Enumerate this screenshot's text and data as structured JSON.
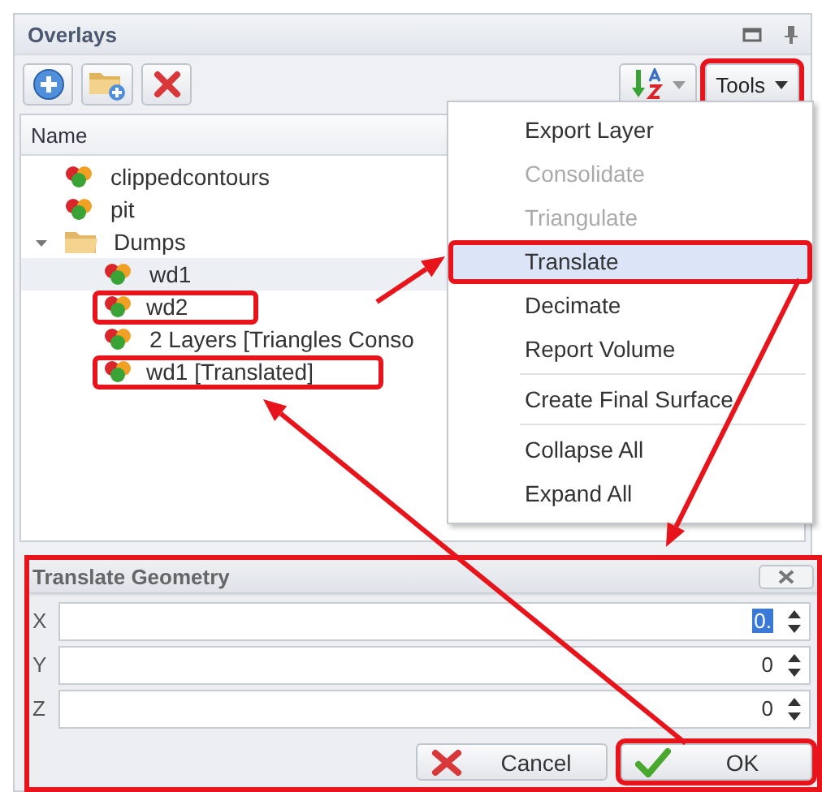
{
  "panel": {
    "title": "Overlays"
  },
  "toolbar": {
    "buttons": [
      {
        "kind": "add"
      },
      {
        "kind": "add-folder"
      },
      {
        "kind": "delete"
      },
      {
        "kind": "sort"
      }
    ],
    "tools": {
      "label": "Tools",
      "highlighted": true
    }
  },
  "tree": {
    "column": "Name",
    "items": [
      {
        "label": "clippedcontours",
        "kind": "layer",
        "hovered": false,
        "highlighted": false
      },
      {
        "label": "pit",
        "kind": "layer",
        "hovered": false,
        "highlighted": false
      },
      {
        "label": "Dumps",
        "kind": "folder",
        "expanded": true,
        "hovered": false,
        "highlighted": false,
        "children": [
          {
            "label": "wd1",
            "kind": "layer",
            "hovered": true,
            "highlighted": false
          },
          {
            "label": "wd2",
            "kind": "layer",
            "hovered": false,
            "highlighted": true
          },
          {
            "label": "2 Layers [Triangles Conso",
            "kind": "layer",
            "hovered": false,
            "highlighted": false
          },
          {
            "label": "wd1 [Translated]",
            "kind": "layer",
            "hovered": false,
            "highlighted": true
          }
        ]
      }
    ]
  },
  "menu": {
    "items": [
      {
        "label": "Export Layer",
        "disabled": false,
        "selected": false,
        "highlighted": false,
        "separator_before": false
      },
      {
        "label": "Consolidate",
        "disabled": true,
        "selected": false,
        "highlighted": false,
        "separator_before": false
      },
      {
        "label": "Triangulate",
        "disabled": true,
        "selected": false,
        "highlighted": false,
        "separator_before": false
      },
      {
        "label": "Translate",
        "disabled": false,
        "selected": true,
        "highlighted": true,
        "separator_before": false
      },
      {
        "label": "Decimate",
        "disabled": false,
        "selected": false,
        "highlighted": false,
        "separator_before": false
      },
      {
        "label": "Report Volume",
        "disabled": false,
        "selected": false,
        "highlighted": false,
        "separator_before": false
      },
      {
        "label": "Create Final Surface",
        "disabled": false,
        "selected": false,
        "highlighted": false,
        "separator_before": true
      },
      {
        "label": "Collapse All",
        "disabled": false,
        "selected": false,
        "highlighted": false,
        "separator_before": true
      },
      {
        "label": "Expand All",
        "disabled": false,
        "selected": false,
        "highlighted": false,
        "separator_before": false
      }
    ]
  },
  "dialog": {
    "title": "Translate Geometry",
    "highlighted": true,
    "fields": [
      {
        "label": "X",
        "value": "0.",
        "focused": true
      },
      {
        "label": "Y",
        "value": "0",
        "focused": false
      },
      {
        "label": "Z",
        "value": "0",
        "focused": false
      }
    ],
    "buttons": [
      {
        "label": "Cancel",
        "kind": "cancel",
        "highlighted": false
      },
      {
        "label": "OK",
        "kind": "ok",
        "highlighted": true
      }
    ]
  },
  "arrows": true
}
